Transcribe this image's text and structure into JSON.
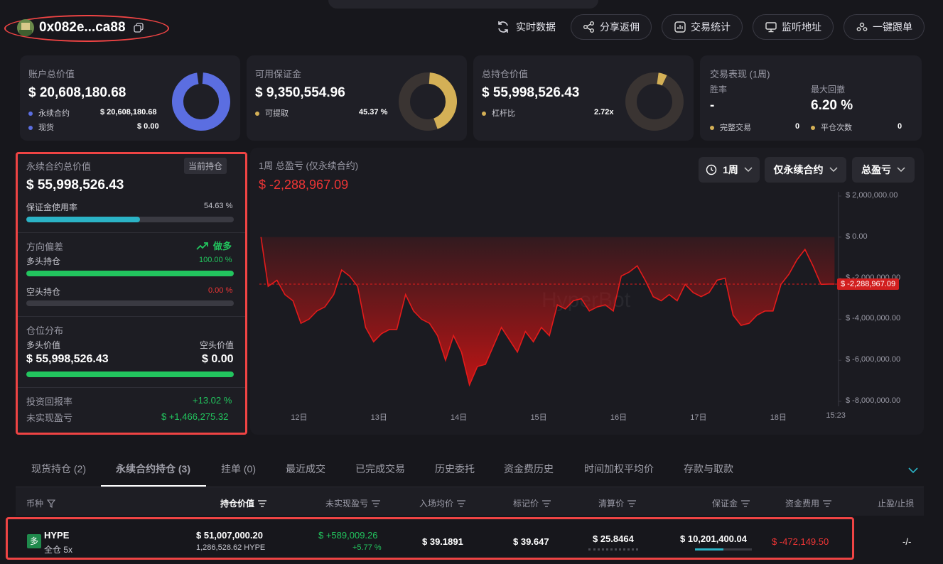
{
  "header": {
    "address": "0x082e...ca88",
    "buttons": {
      "realtime": "实时数据",
      "share": "分享返佣",
      "stats": "交易统计",
      "monitor": "监听地址",
      "copy_trade": "一键跟单"
    }
  },
  "summary": {
    "account": {
      "title": "账户总价值",
      "value": "$ 20,608,180.68",
      "rows": [
        {
          "label": "永续合约",
          "value": "$ 20,608,180.68"
        },
        {
          "label": "现货",
          "value": "$ 0.00"
        }
      ]
    },
    "margin": {
      "title": "可用保证金",
      "value": "$ 9,350,554.96",
      "row_label": "可提取",
      "row_value": "45.37 %",
      "ratio": 0.4537
    },
    "positions": {
      "title": "总持仓价值",
      "value": "$ 55,998,526.43",
      "row_label": "杠杆比",
      "row_value": "2.72x"
    },
    "performance": {
      "title": "交易表现 (1周)",
      "win_label": "胜率",
      "win_value": "-",
      "drawdown_label": "最大回撤",
      "drawdown_value": "6.20 %",
      "complete_label": "完整交易",
      "complete_value": "0",
      "close_label": "平仓次数",
      "close_value": "0"
    }
  },
  "perp": {
    "title": "永续合约总价值",
    "badge": "当前持仓",
    "value": "$ 55,998,526.43",
    "margin_usage_label": "保证金使用率",
    "margin_usage_value": "54.63 %",
    "margin_usage_ratio": 0.5463,
    "bias_label": "方向偏差",
    "bias_value": "做多",
    "long_label": "多头持仓",
    "long_pct": "100.00 %",
    "long_ratio": 1.0,
    "short_label": "空头持仓",
    "short_pct": "0.00 %",
    "short_ratio": 0.0,
    "dist_label": "仓位分布",
    "long_value_label": "多头价值",
    "short_value_label": "空头价值",
    "long_value": "$ 55,998,526.43",
    "short_value": "$ 0.00",
    "roi_label": "投资回报率",
    "roi_value": "+13.02 %",
    "upnl_label": "未实现盈亏",
    "upnl_value": "$ +1,466,275.32"
  },
  "pnl": {
    "title": "1周 总盈亏 (仅永续合约)",
    "value": "$ -2,288,967.09",
    "period": "1周",
    "scope": "仅永续合约",
    "metric": "总盈亏",
    "current_label": "$ -2,288,967.09",
    "watermark": "HyperBot"
  },
  "chart_data": {
    "type": "area",
    "title": "1周 总盈亏 (仅永续合约)",
    "y_tick_labels": [
      "$ 2,000,000.00",
      "$ 0.00",
      "$ -2,000,000.00",
      "$ -4,000,000.00",
      "$ -6,000,000.00",
      "$ -8,000,000.00"
    ],
    "y_ticks": [
      2000000,
      0,
      -2000000,
      -4000000,
      -6000000,
      -8000000
    ],
    "x_tick_labels": [
      "12日",
      "13日",
      "14日",
      "15日",
      "16日",
      "17日",
      "18日",
      "15:23"
    ],
    "x_tick_days": [
      1,
      2,
      3,
      4,
      5,
      6,
      7,
      7.7
    ],
    "ylim": [
      -8000000,
      2000000
    ],
    "xlim": [
      0.5,
      7.75
    ],
    "current": -2288967.09,
    "series": [
      {
        "x": [
          0.52,
          0.61,
          0.72,
          0.82,
          0.92,
          1.02,
          1.12,
          1.22,
          1.32,
          1.43,
          1.53,
          1.63,
          1.73,
          1.83,
          1.93,
          2.03,
          2.13,
          2.22,
          2.33,
          2.43,
          2.53,
          2.63,
          2.73,
          2.83,
          2.93,
          3.03,
          3.13,
          3.23,
          3.33,
          3.43,
          3.53,
          3.63,
          3.73,
          3.83,
          3.93,
          4.03,
          4.13,
          4.23,
          4.33,
          4.43,
          4.53,
          4.63,
          4.73,
          4.83,
          4.93,
          5.03,
          5.13,
          5.23,
          5.33,
          5.43,
          5.53,
          5.63,
          5.73,
          5.83,
          5.93,
          6.03,
          6.13,
          6.23,
          6.33,
          6.43,
          6.53,
          6.63,
          6.73,
          6.83,
          6.93,
          7.03,
          7.13,
          7.23,
          7.33,
          7.43,
          7.53,
          7.63,
          7.7
        ],
        "y": [
          0.0,
          -2.4,
          -2.1,
          -2.8,
          -3.1,
          -4.2,
          -4.0,
          -3.6,
          -3.4,
          -2.8,
          -1.6,
          -1.9,
          -2.4,
          -4.4,
          -5.1,
          -4.7,
          -4.5,
          -4.5,
          -2.8,
          -3.6,
          -4.0,
          -4.2,
          -4.8,
          -6.0,
          -4.8,
          -5.6,
          -7.2,
          -6.3,
          -6.2,
          -5.3,
          -4.4,
          -5.0,
          -5.6,
          -4.6,
          -5.1,
          -4.4,
          -4.8,
          -3.3,
          -3.5,
          -3.1,
          -3.0,
          -3.6,
          -3.4,
          -3.3,
          -3.6,
          -1.9,
          -1.7,
          -1.4,
          -2.1,
          -2.9,
          -3.1,
          -2.8,
          -3.1,
          -2.3,
          -2.7,
          -2.9,
          -2.7,
          -2.1,
          -2.0,
          -3.8,
          -4.3,
          -4.2,
          -3.8,
          -3.6,
          -3.6,
          -2.3,
          -1.8,
          -1.1,
          -0.6,
          -1.4,
          -2.3,
          -2.29,
          -2.29
        ]
      }
    ]
  },
  "tabs": [
    "现货持仓 (2)",
    "永续合约持仓 (3)",
    "挂单 (0)",
    "最近成交",
    "已完成交易",
    "历史委托",
    "资金费历史",
    "时间加权平均价",
    "存款与取款"
  ],
  "table": {
    "headers": {
      "coin": "币种",
      "value": "持仓价值",
      "upnl": "未实现盈亏",
      "entry": "入场均价",
      "mark": "标记价",
      "liq": "清算价",
      "margin": "保证金",
      "funding": "资金费用",
      "tpsl": "止盈/止损"
    },
    "rows": [
      {
        "side_badge": "多",
        "coin": "HYPE",
        "mode": "全仓 5x",
        "value": "$ 51,007,000.20",
        "size": "1,286,528.62 HYPE",
        "upnl": "$ +589,009.26",
        "upnl_pct": "+5.77 %",
        "entry": "$ 39.1891",
        "mark": "$ 39.647",
        "liq": "$ 25.8464",
        "margin": "$ 10,201,400.04",
        "funding": "$ -472,149.50",
        "tpsl": "-/-"
      }
    ]
  },
  "colors": {
    "accent_blue": "#5b6ee1",
    "gold": "#d4b056",
    "green": "#22c55e",
    "red": "#ef3535",
    "cyan": "#2bb3c6"
  }
}
